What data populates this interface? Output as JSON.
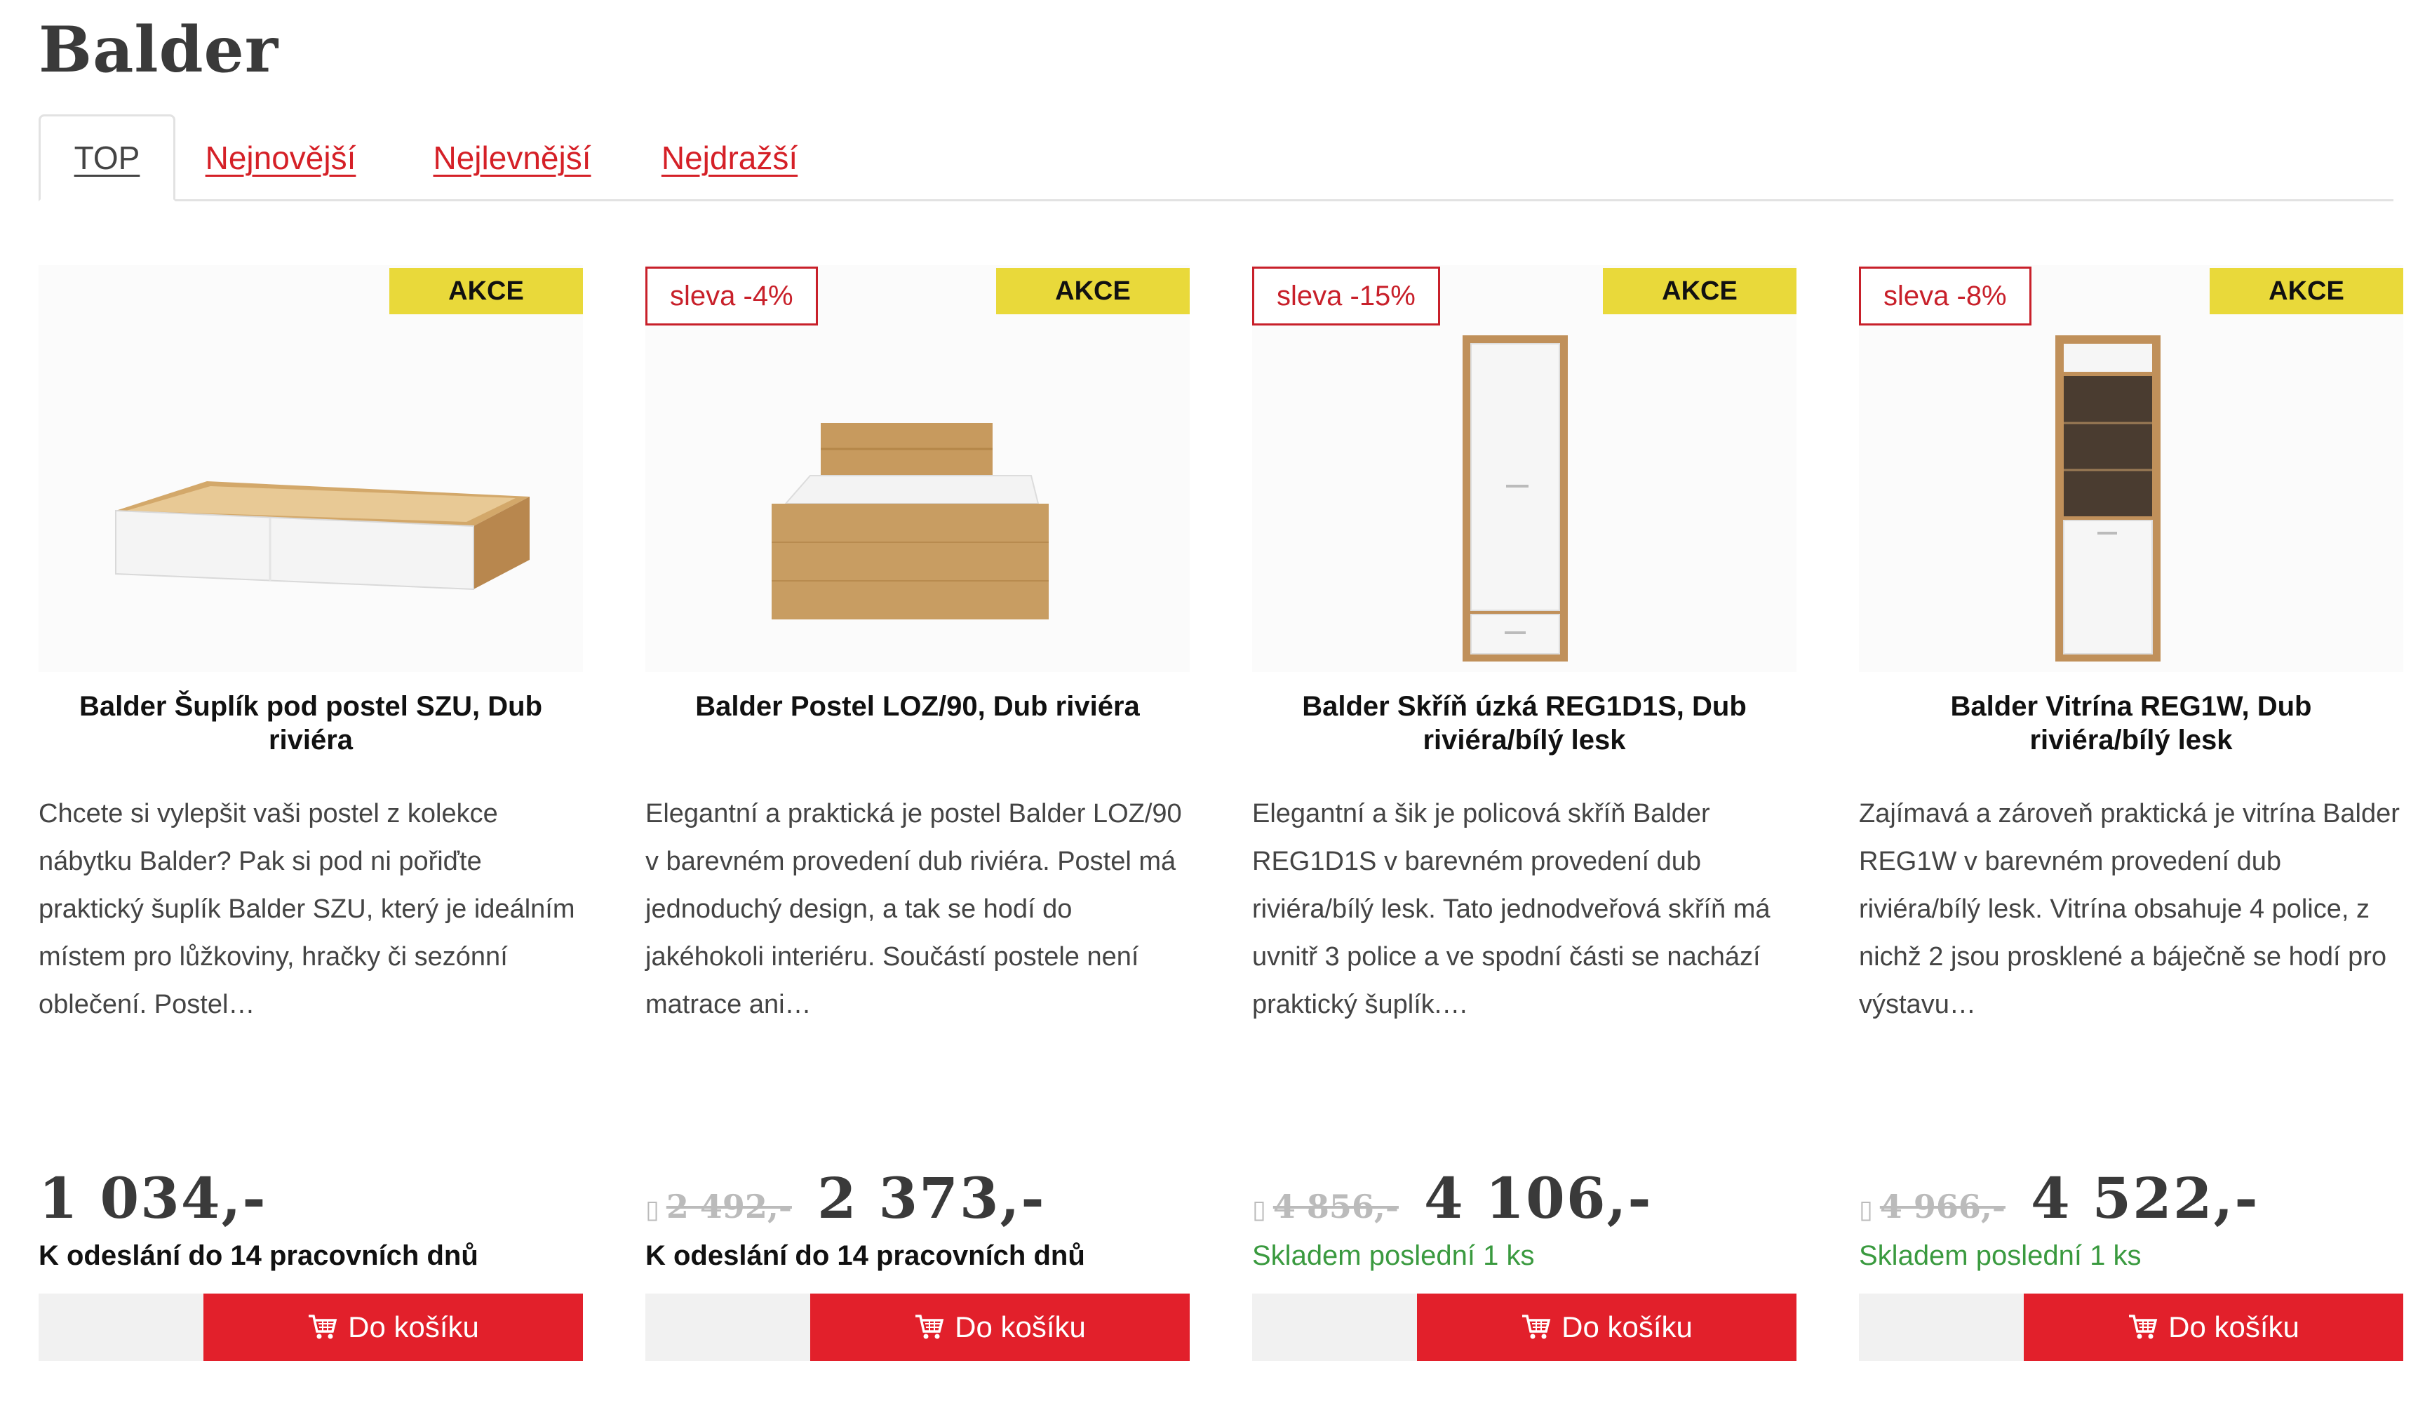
{
  "page": {
    "title": "Balder"
  },
  "tabs": [
    {
      "label": "TOP",
      "active": true
    },
    {
      "label": "Nejnovější",
      "active": false
    },
    {
      "label": "Nejlevnější",
      "active": false
    },
    {
      "label": "Nejdražší",
      "active": false
    }
  ],
  "colors": {
    "accent_red": "#e2202b",
    "badge_yellow": "#e9d93a",
    "stock_green": "#3a9a3f",
    "tab_link": "#d52027"
  },
  "products": [
    {
      "badge_akce": "AKCE",
      "badge_sleva": "",
      "image_icon": "drawer-image",
      "title": "Balder Šuplík pod postel SZU, Dub riviéra",
      "description": "Chcete si vylepšit vaši postel z kolekce nábytku Balder? Pak si pod ni pořiďte praktický šuplík Balder SZU, který je ideálním místem pro lůžkoviny, hračky či sezónní oblečení. Postel…",
      "price_old": "",
      "price_new": "1 034,-",
      "availability": "K odeslání do 14 pracovních dnů",
      "buy_label": "Do košíku"
    },
    {
      "badge_akce": "AKCE",
      "badge_sleva": "sleva -4%",
      "image_icon": "bed-image",
      "title": "Balder Postel LOZ/90, Dub riviéra",
      "description": "Elegantní a praktická je postel Balder LOZ/90 v barevném provedení dub riviéra. Postel má jednoduchý design, a tak se hodí do jakéhokoli interiéru. Součástí postele není matrace ani…",
      "price_old": "2 492,-",
      "price_new": "2 373,-",
      "availability": "K odeslání do 14 pracovních dnů",
      "buy_label": "Do košíku"
    },
    {
      "badge_akce": "AKCE",
      "badge_sleva": "sleva -15%",
      "image_icon": "wardrobe-image",
      "title": "Balder Skříň úzká REG1D1S, Dub riviéra/bílý lesk",
      "description": "Elegantní a šik je policová skříň Balder REG1D1S v barevném provedení dub riviéra/bílý lesk. Tato jednodveřová skříň má uvnitř 3 police a ve spodní části se nachází praktický šuplík.…",
      "price_old": "4 856,-",
      "price_new": "4 106,-",
      "availability": "Skladem poslední 1 ks",
      "buy_label": "Do košíku"
    },
    {
      "badge_akce": "AKCE",
      "badge_sleva": "sleva -8%",
      "image_icon": "vitrine-image",
      "title": "Balder Vitrína REG1W, Dub riviéra/bílý lesk",
      "description": "Zajímavá a zároveň praktická je vitrína Balder REG1W v barevném provedení dub riviéra/bílý lesk. Vitrína obsahuje 4 police, z nichž 2 jsou prosklené a báječně se hodí pro výstavu…",
      "price_old": "4 966,-",
      "price_new": "4 522,-",
      "availability": "Skladem poslední 1 ks",
      "buy_label": "Do košíku"
    }
  ]
}
